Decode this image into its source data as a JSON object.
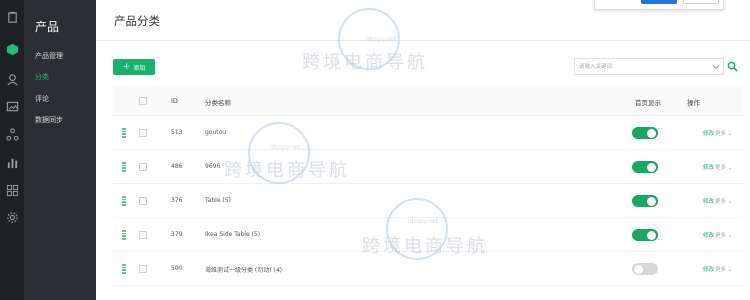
{
  "rail": {
    "icons": [
      "clipboard-icon",
      "cube-icon",
      "user-icon",
      "image-icon",
      "share-icon",
      "bar-chart-icon",
      "grid-icon",
      "settings-icon"
    ]
  },
  "subnav": {
    "title": "产品",
    "items": [
      {
        "label": "产品管理",
        "active": false
      },
      {
        "label": "分类",
        "active": true
      },
      {
        "label": "评论",
        "active": false
      },
      {
        "label": "数据同步",
        "active": false
      }
    ]
  },
  "page": {
    "title": "产品分类",
    "add_label": "添加",
    "search_placeholder": "请输入关键词"
  },
  "table": {
    "headers": {
      "id": "ID",
      "name": "分类名称",
      "home": "首页显示",
      "actions": "操作"
    },
    "edit_label": "修改",
    "more_label": "更多",
    "rows": [
      {
        "id": "513",
        "name": "goutou",
        "home": true
      },
      {
        "id": "486",
        "name": "9696",
        "home": true
      },
      {
        "id": "376",
        "name": "Table (5)",
        "home": true
      },
      {
        "id": "379",
        "name": "Ikea Side Table (5)",
        "home": true
      },
      {
        "id": "500",
        "name": "海维测试一级分类 (勿动) (4)",
        "home": false
      }
    ]
  },
  "watermark": {
    "text": "跨境电商导航",
    "url": "idcspy.net"
  },
  "colors": {
    "accent": "#17b26b",
    "toggle_on": "#18a85f",
    "toggle_off": "#d8d8d8",
    "rail_bg": "#1f2225",
    "subnav_bg": "#2b2e32"
  }
}
